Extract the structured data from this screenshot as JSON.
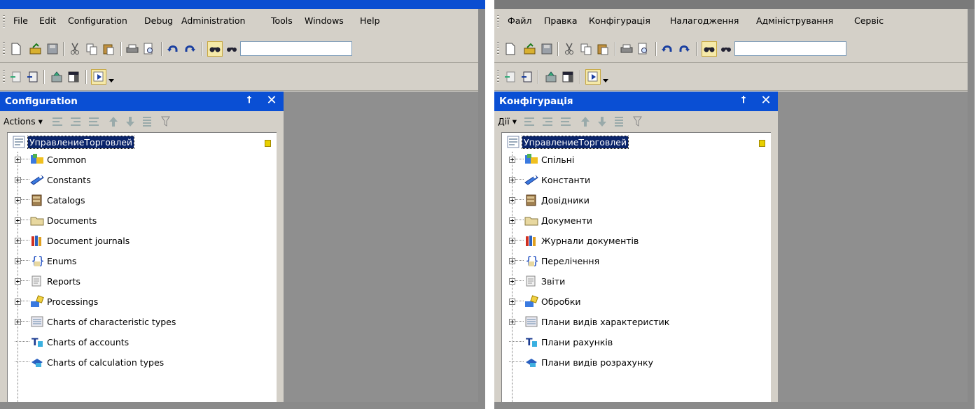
{
  "left": {
    "menu": [
      "File",
      "Edit",
      "Configuration",
      "Debug",
      "Administration",
      "Tools",
      "Windows",
      "Help"
    ],
    "panel_title": "Configuration",
    "actions_label": "Actions",
    "root": "УправлениеТорговлей",
    "items": [
      "Common",
      "Constants",
      "Catalogs",
      "Documents",
      "Document journals",
      "Enums",
      "Reports",
      "Processings",
      "Charts of characteristic types",
      "Charts of accounts",
      "Charts of calculation types"
    ]
  },
  "right": {
    "menu": [
      "Файл",
      "Правка",
      "Конфігурація",
      "Налагодження",
      "Адміністрування",
      "Сервіс"
    ],
    "panel_title": "Конфігурація",
    "actions_label": "Дії",
    "root": "УправлениеТорговлей",
    "items": [
      "Спільні",
      "Константи",
      "Довідники",
      "Документи",
      "Журнали документів",
      "Перелічення",
      "Звіти",
      "Обробки",
      "Плани видів характеристик",
      "Плани рахунків",
      "Плани видів розрахунку"
    ]
  },
  "icons": [
    "common-icon",
    "constants-icon",
    "catalogs-icon",
    "documents-icon",
    "document-journals-icon",
    "enums-icon",
    "reports-icon",
    "processings-icon",
    "charts-of-characteristic-types-icon",
    "charts-of-accounts-icon",
    "charts-of-calculation-types-icon"
  ],
  "colors": {
    "title_bar": "#0a4fd4",
    "workspace": "#8f8f8f",
    "selection": "#0a246a",
    "window_face": "#d4d0c8"
  }
}
